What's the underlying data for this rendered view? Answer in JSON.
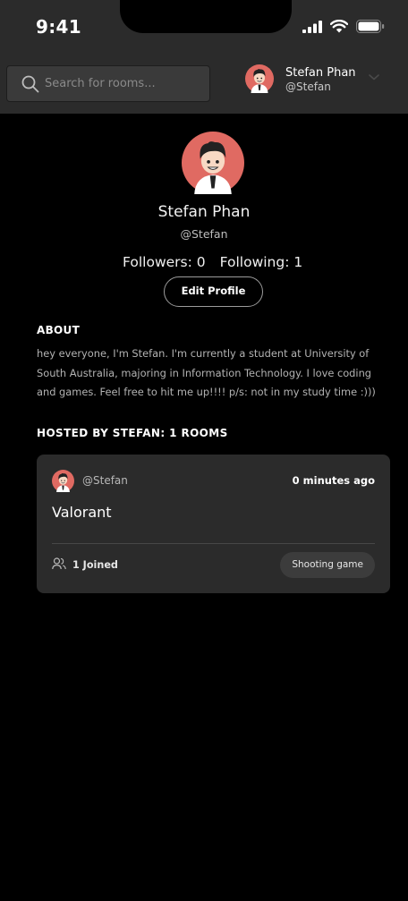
{
  "status_bar": {
    "time": "9:41"
  },
  "header": {
    "search": {
      "placeholder": "Search for rooms..."
    },
    "user": {
      "name": "Stefan Phan",
      "handle": "@Stefan"
    }
  },
  "profile": {
    "name": "Stefan Phan",
    "handle": "@Stefan",
    "followers_label": "Followers: 0",
    "following_label": "Following: 1",
    "edit_label": "Edit Profile"
  },
  "about": {
    "title": "ABOUT",
    "text": "hey everyone, I'm Stefan. I'm currently a student at University of South Australia, majoring in Information Technology. I love coding and games. Feel free to hit me up!!!! p/s: not in my study time :)))"
  },
  "hosted": {
    "title": "HOSTED BY STEFAN: 1 ROOMS",
    "rooms": [
      {
        "host": "@Stefan",
        "time": "0 minutes ago",
        "title": "Valorant",
        "joined": "1 Joined",
        "tag": "Shooting game"
      }
    ]
  },
  "icons": {
    "search": "search-icon",
    "chevron": "chevron-down-icon",
    "signal": "signal-icon",
    "wifi": "wifi-icon",
    "battery": "battery-icon",
    "users": "users-icon"
  },
  "colors": {
    "background": "#000000",
    "panel": "#2b2b2b",
    "avatar_bg": "#e06a62"
  }
}
